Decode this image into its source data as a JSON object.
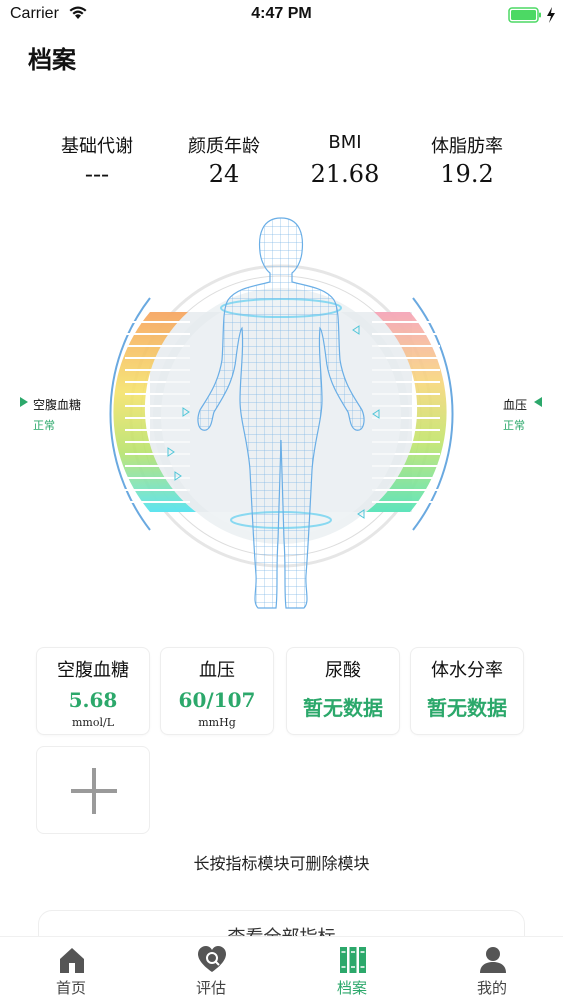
{
  "status_bar": {
    "carrier": "Carrier",
    "time": "4:47 PM",
    "battery_color": "#4cd964"
  },
  "page": {
    "title": "档案"
  },
  "metrics": [
    {
      "label": "基础代谢",
      "value": "---"
    },
    {
      "label": "颜质年龄",
      "value": "24"
    },
    {
      "label": "BMI",
      "value": "21.68"
    },
    {
      "label": "体脂肪率",
      "value": "19.2"
    }
  ],
  "body_graphic": {
    "left_indicator": {
      "label": "空腹血糖",
      "status": "正常"
    },
    "right_indicator": {
      "label": "血压",
      "status": "正常"
    },
    "status_color": "#2ca86b"
  },
  "cards": [
    {
      "title": "空腹血糖",
      "value": "5.68",
      "unit": "mmol/L"
    },
    {
      "title": "血压",
      "value": "60/107",
      "unit": "mmHg"
    },
    {
      "title": "尿酸",
      "no_data": "暂无数据"
    },
    {
      "title": "体水分率",
      "no_data": "暂无数据"
    }
  ],
  "add_card": {
    "icon": "plus-icon"
  },
  "hint": "长按指标模块可删除模块",
  "view_all": "查看全部指标",
  "tabs": [
    {
      "label": "首页",
      "icon": "home-icon",
      "active": false
    },
    {
      "label": "评估",
      "icon": "heart-assessment-icon",
      "active": false
    },
    {
      "label": "档案",
      "icon": "files-icon",
      "active": true
    },
    {
      "label": "我的",
      "icon": "person-icon",
      "active": false
    }
  ],
  "colors": {
    "accent": "#2ca86b",
    "text": "#111111"
  }
}
